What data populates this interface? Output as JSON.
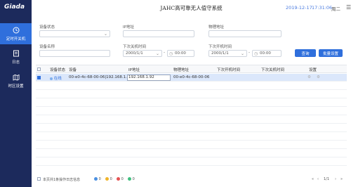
{
  "sidebar": {
    "logo": "Giada",
    "items": [
      {
        "label": "定时开关机",
        "icon": "clock-icon",
        "active": true
      },
      {
        "label": "日志",
        "icon": "log-icon",
        "active": false
      },
      {
        "label": "时区设置",
        "icon": "map-icon",
        "active": false
      }
    ]
  },
  "header": {
    "title": "JAHC高可靠无人值守系统",
    "date": "2019-12-17",
    "time": "17:31:06",
    "weekday": "周二",
    "menu_icon": "hamburger-icon"
  },
  "form": {
    "device_status_label": "设备状态",
    "device_status_value": "",
    "ip_label": "IP地址",
    "ip_value": "",
    "mac_label": "物理地址",
    "mac_value": "",
    "device_name_label": "设备名称",
    "device_name_value": "",
    "next_shutdown_label": "下次关机时间",
    "next_shutdown_date": "2000/1/1",
    "next_shutdown_time": "00:00",
    "next_boot_label": "下次开机时间",
    "next_boot_date": "2000/1/1",
    "next_boot_time": "00:00",
    "query_button": "查询",
    "batch_button": "批量设置"
  },
  "table": {
    "columns": [
      "设备状态",
      "设备",
      "IP地址",
      "物理地址",
      "下次开机时间",
      "下次关机时间",
      "设置"
    ],
    "rows": [
      {
        "status": "在线",
        "device": "00-e0-4c-68-00-06|192.168.1.92",
        "ip": "192.168.1.92",
        "mac": "00-e0-4c-68-00-06",
        "next_boot": "",
        "next_shutdown": "",
        "checked": true
      }
    ]
  },
  "footer": {
    "page_info": "本页共1条操作日志信息",
    "count_info": "0",
    "count_warn": "0",
    "count_error": "0",
    "count_ok": "0",
    "page_indicator": "1/1",
    "nav_first": "«",
    "nav_prev": "‹",
    "nav_next": "›",
    "nav_last": "»"
  },
  "colors": {
    "sidebar_bg": "#1c2a5c",
    "accent": "#2f6fdc",
    "selected_row": "#dbe7fb"
  }
}
